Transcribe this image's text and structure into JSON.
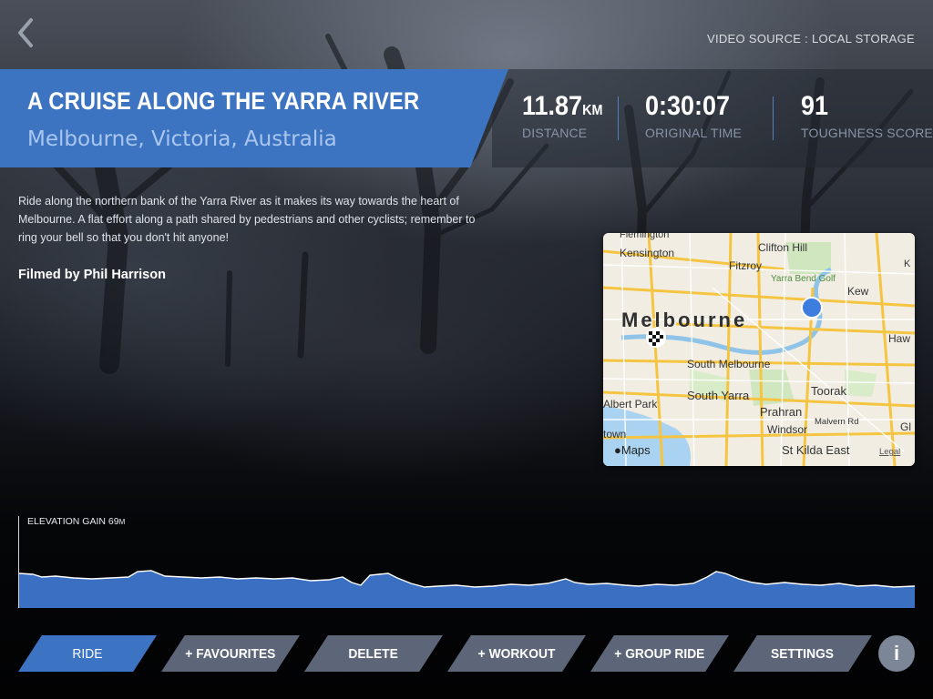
{
  "header": {
    "back_icon": "chevron-left-icon",
    "video_source": "VIDEO SOURCE : LOCAL STORAGE"
  },
  "ride": {
    "title": "A CRUISE ALONG THE YARRA RIVER",
    "location": "Melbourne, Victoria, Australia",
    "description": "Ride along the northern bank of the Yarra River as it makes its way towards the heart of Melbourne. A flat effort along a path shared by pedestrians and other cyclists; remember to ring your bell so that you don't hit anyone!",
    "filmed_by": "Filmed by Phil Harrison"
  },
  "stats": {
    "distance": {
      "value": "11.87",
      "unit": "KM",
      "label": "DISTANCE"
    },
    "time": {
      "value": "0:30:07",
      "label": "ORIGINAL TIME"
    },
    "toughness": {
      "value": "91",
      "label": "TOUGHNESS SCORE"
    }
  },
  "map": {
    "labels": {
      "flemington": "Flemington",
      "kensington": "Kensington",
      "clifton_hill": "Clifton Hill",
      "fitzroy": "Fitzroy",
      "yarra_bend": "Yarra Bend Golf",
      "kew": "Kew",
      "k": "K",
      "melbourne": "Melbourne",
      "haw": "Haw",
      "south_melbourne": "South Melbourne",
      "albert_park": "Albert Park",
      "south_yarra": "South Yarra",
      "toorak": "Toorak",
      "prahran": "Prahran",
      "malvern_rd": "Malvern Rd",
      "windsor": "Windsor",
      "gl": "Gl",
      "town": "town",
      "st_kilda_east": "St Kilda East",
      "maps_brand": "Maps",
      "legal": "Legal"
    }
  },
  "elevation": {
    "label": "ELEVATION GAIN",
    "value": "69",
    "unit": "M"
  },
  "nav": {
    "ride": "RIDE",
    "favourites": "+ FAVOURITES",
    "delete": "DELETE",
    "workout": "+ WORKOUT",
    "group_ride": "+ GROUP RIDE",
    "settings": "SETTINGS",
    "info": "i"
  },
  "colors": {
    "accent": "#3d74c2",
    "button": "#5c6678",
    "location_text": "#a9c7ee",
    "stat_label": "#8793a6"
  }
}
